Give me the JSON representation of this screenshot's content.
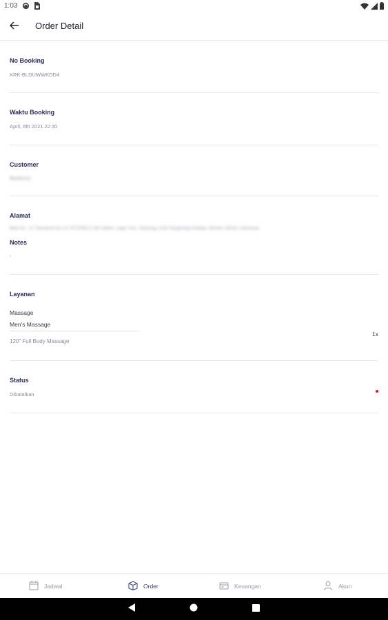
{
  "status_bar": {
    "time": "1:03",
    "left_icons": [
      "sync-icon",
      "sim-card-icon"
    ],
    "right_icons": [
      "wifi-icon",
      "signal-icon",
      "battery-icon"
    ]
  },
  "app_bar": {
    "title": "Order Detail",
    "back_icon": "arrow-left-icon"
  },
  "fields": {
    "no_booking": {
      "label": "No Booking",
      "value": "KRK-BLDUWWKDD4"
    },
    "waktu_booking": {
      "label": "Waktu Booking",
      "value": "April, 8th 2021 22:30"
    },
    "customer": {
      "label": "Customer",
      "value": "Beckenzi"
    },
    "alamat": {
      "label": "Alamat",
      "value": "Blok H1 , Jl. Sarotama No.14, RT.2/RW.3, Bin Nahar, Lajas, Kec. Serpong, Kota Tangerang Selatan, Banten 15310, Indonesia"
    },
    "notes": {
      "label": "Notes",
      "value": "-"
    },
    "layanan": {
      "label": "Layanan",
      "category": "Massage",
      "service": "Men's Massage",
      "detail": "120\" Full Body Massage",
      "qty": "1x"
    },
    "status": {
      "label": "Status",
      "value": "Dibatalkan",
      "dot_color": "#c21d2c"
    }
  },
  "bottom_nav": {
    "items": [
      {
        "label": "Jadwal",
        "icon": "calendar-icon"
      },
      {
        "label": "Order",
        "icon": "box-icon",
        "active": true
      },
      {
        "label": "Keuangan",
        "icon": "wallet-icon"
      },
      {
        "label": "Akun",
        "icon": "user-icon"
      }
    ]
  },
  "system_nav": {
    "icons": [
      "back-triangle-icon",
      "home-circle-icon",
      "recents-square-icon"
    ]
  },
  "colors": {
    "accent": "#3a3f7a",
    "label": "#2b2d5a",
    "muted": "#8a8a98",
    "status_cancelled": "#c21d2c"
  }
}
